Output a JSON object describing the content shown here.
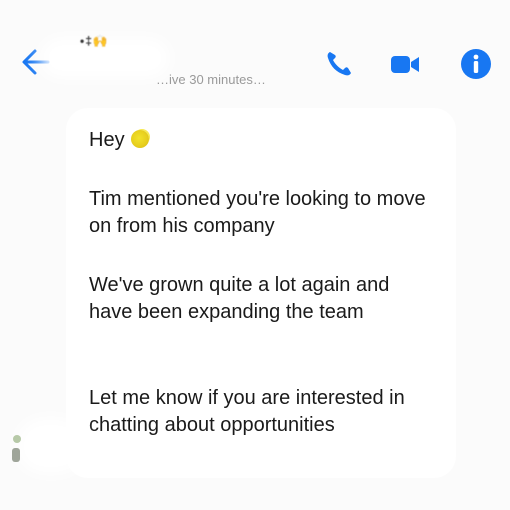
{
  "header": {
    "contact_name": "•‡🙌",
    "status": "…ive 30 minutes…",
    "accent_color": "#1877f2"
  },
  "icons": {
    "back": "arrow-left-icon",
    "call": "phone-icon",
    "video": "video-camera-icon",
    "info": "info-icon",
    "wave": "waving-hand-emoji"
  },
  "message": {
    "greeting": "Hey",
    "paragraph_2": "Tim mentioned you're looking to move on from his company",
    "paragraph_3": "We've grown quite a lot again and have been expanding the team",
    "paragraph_4": "Let me know if you are interested in chatting about opportunities"
  }
}
